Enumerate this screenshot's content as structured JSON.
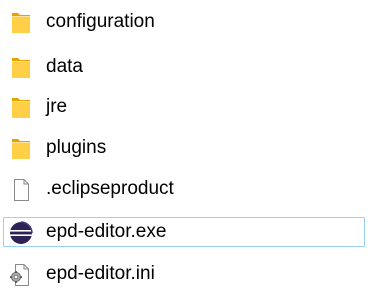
{
  "colors": {
    "folder_front": "#ffcf48",
    "folder_back": "#e8a200",
    "selection_border": "#99d1ff",
    "eclipse_purple": "#2c2255",
    "text": "#000000"
  },
  "files": [
    {
      "name": "configuration",
      "icon": "folder-icon",
      "selected": false
    },
    {
      "name": "data",
      "icon": "folder-icon",
      "selected": false
    },
    {
      "name": "jre",
      "icon": "folder-icon",
      "selected": false
    },
    {
      "name": "plugins",
      "icon": "folder-icon",
      "selected": false
    },
    {
      "name": ".eclipseproduct",
      "icon": "blank-file-icon",
      "selected": false
    },
    {
      "name": "epd-editor.exe",
      "icon": "eclipse-icon",
      "selected": true
    },
    {
      "name": "epd-editor.ini",
      "icon": "settings-file-icon",
      "selected": false
    }
  ]
}
